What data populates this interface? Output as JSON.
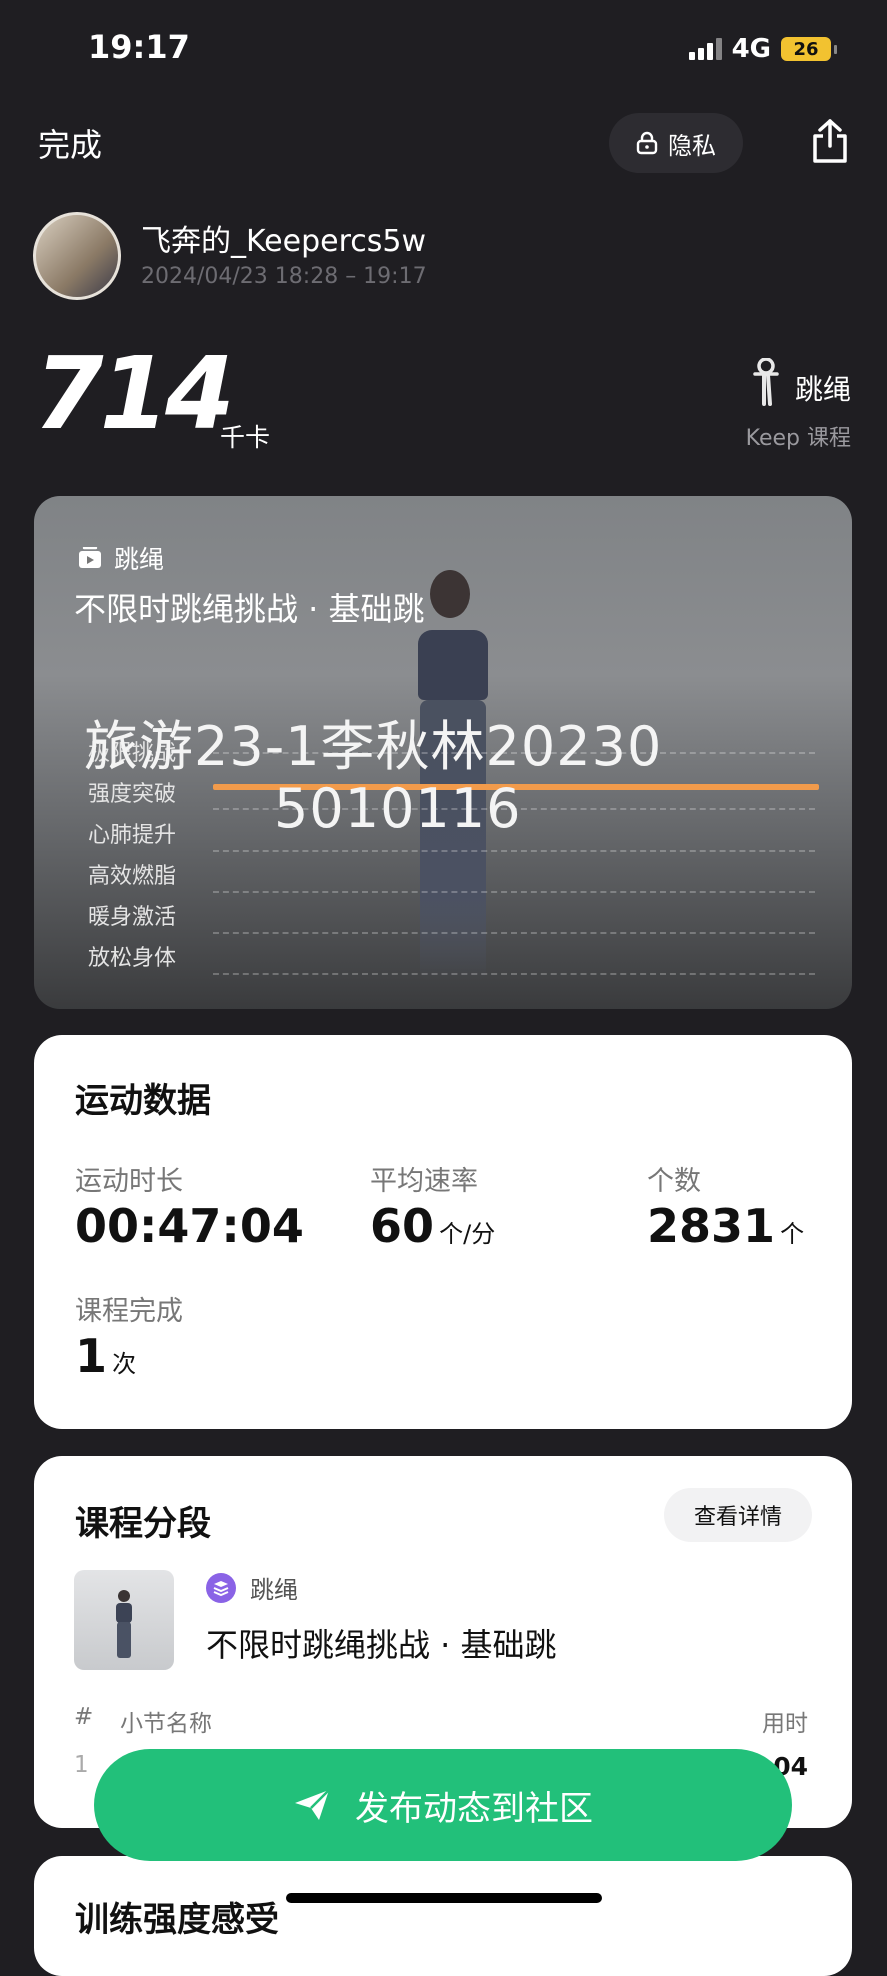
{
  "status_bar": {
    "time": "19:17",
    "network": "4G",
    "battery": "26"
  },
  "header": {
    "done_label": "完成",
    "privacy_label": "隐私"
  },
  "user": {
    "name": "飞奔的_Keepercs5w",
    "time_range": "2024/04/23 18:28 – 19:17"
  },
  "calories": {
    "value": "714",
    "unit": "千卡"
  },
  "sport": {
    "type_label": "跳绳",
    "course_tag": "Keep 课程"
  },
  "hero": {
    "type_label": "跳绳",
    "title": "不限时跳绳挑战 · 基础跳",
    "segments": [
      "极限挑战",
      "强度突破",
      "心肺提升",
      "高效燃脂",
      "暖身激活",
      "放松身体"
    ],
    "watermark_line1": "旅游23-1李秋林20230",
    "watermark_line2": "5010116",
    "accent_color": "#f29b4b"
  },
  "sport_data": {
    "title": "运动数据",
    "stats": [
      {
        "label": "运动时长",
        "value": "00:47:04",
        "unit": ""
      },
      {
        "label": "平均速率",
        "value": "60",
        "unit": "个/分"
      },
      {
        "label": "个数",
        "value": "2831",
        "unit": "个"
      },
      {
        "label": "课程完成",
        "value": "1",
        "unit": "次"
      }
    ]
  },
  "course_segments": {
    "title": "课程分段",
    "detail_label": "查看详情",
    "item_type": "跳绳",
    "item_title": "不限时跳绳挑战 · 基础跳",
    "table_headers": {
      "index": "#",
      "name": "小节名称",
      "duration": "用时"
    },
    "first_row": {
      "index": "1",
      "duration_partial": "04"
    }
  },
  "intensity": {
    "title": "训练强度感受"
  },
  "publish": {
    "label": "发布动态到社区",
    "color": "#22c07a"
  }
}
